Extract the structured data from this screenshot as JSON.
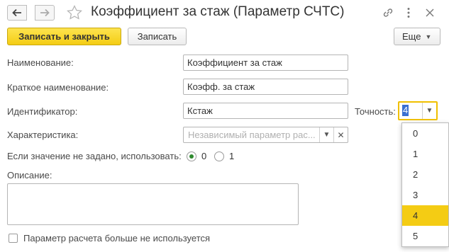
{
  "window": {
    "title": "Коэффициент за стаж (Параметр СЧТС)"
  },
  "toolbar": {
    "save_close_label": "Записать и закрыть",
    "save_label": "Записать",
    "more_label": "Еще"
  },
  "form": {
    "name_label": "Наименование:",
    "name_value": "Коэффициент за стаж",
    "short_name_label": "Краткое наименование:",
    "short_name_value": "Коэфф. за стаж",
    "identifier_label": "Идентификатор:",
    "identifier_value": "Кстаж",
    "precision_label": "Точность:",
    "precision_value": "4",
    "characteristic_label": "Характеристика:",
    "characteristic_placeholder": "Независимый параметр рас...",
    "default_label": "Если значение не задано, использовать:",
    "default_options": [
      "0",
      "1"
    ],
    "default_selected": "0",
    "description_label": "Описание:",
    "description_value": "",
    "unused_label": "Параметр расчета больше не используется"
  },
  "precision_dropdown": {
    "options": [
      "0",
      "1",
      "2",
      "3",
      "4",
      "5"
    ],
    "selected": "4"
  },
  "colors": {
    "accent_yellow": "#f4cc14",
    "focus_border": "#f0c000",
    "radio_dot": "#2f8a2f"
  }
}
